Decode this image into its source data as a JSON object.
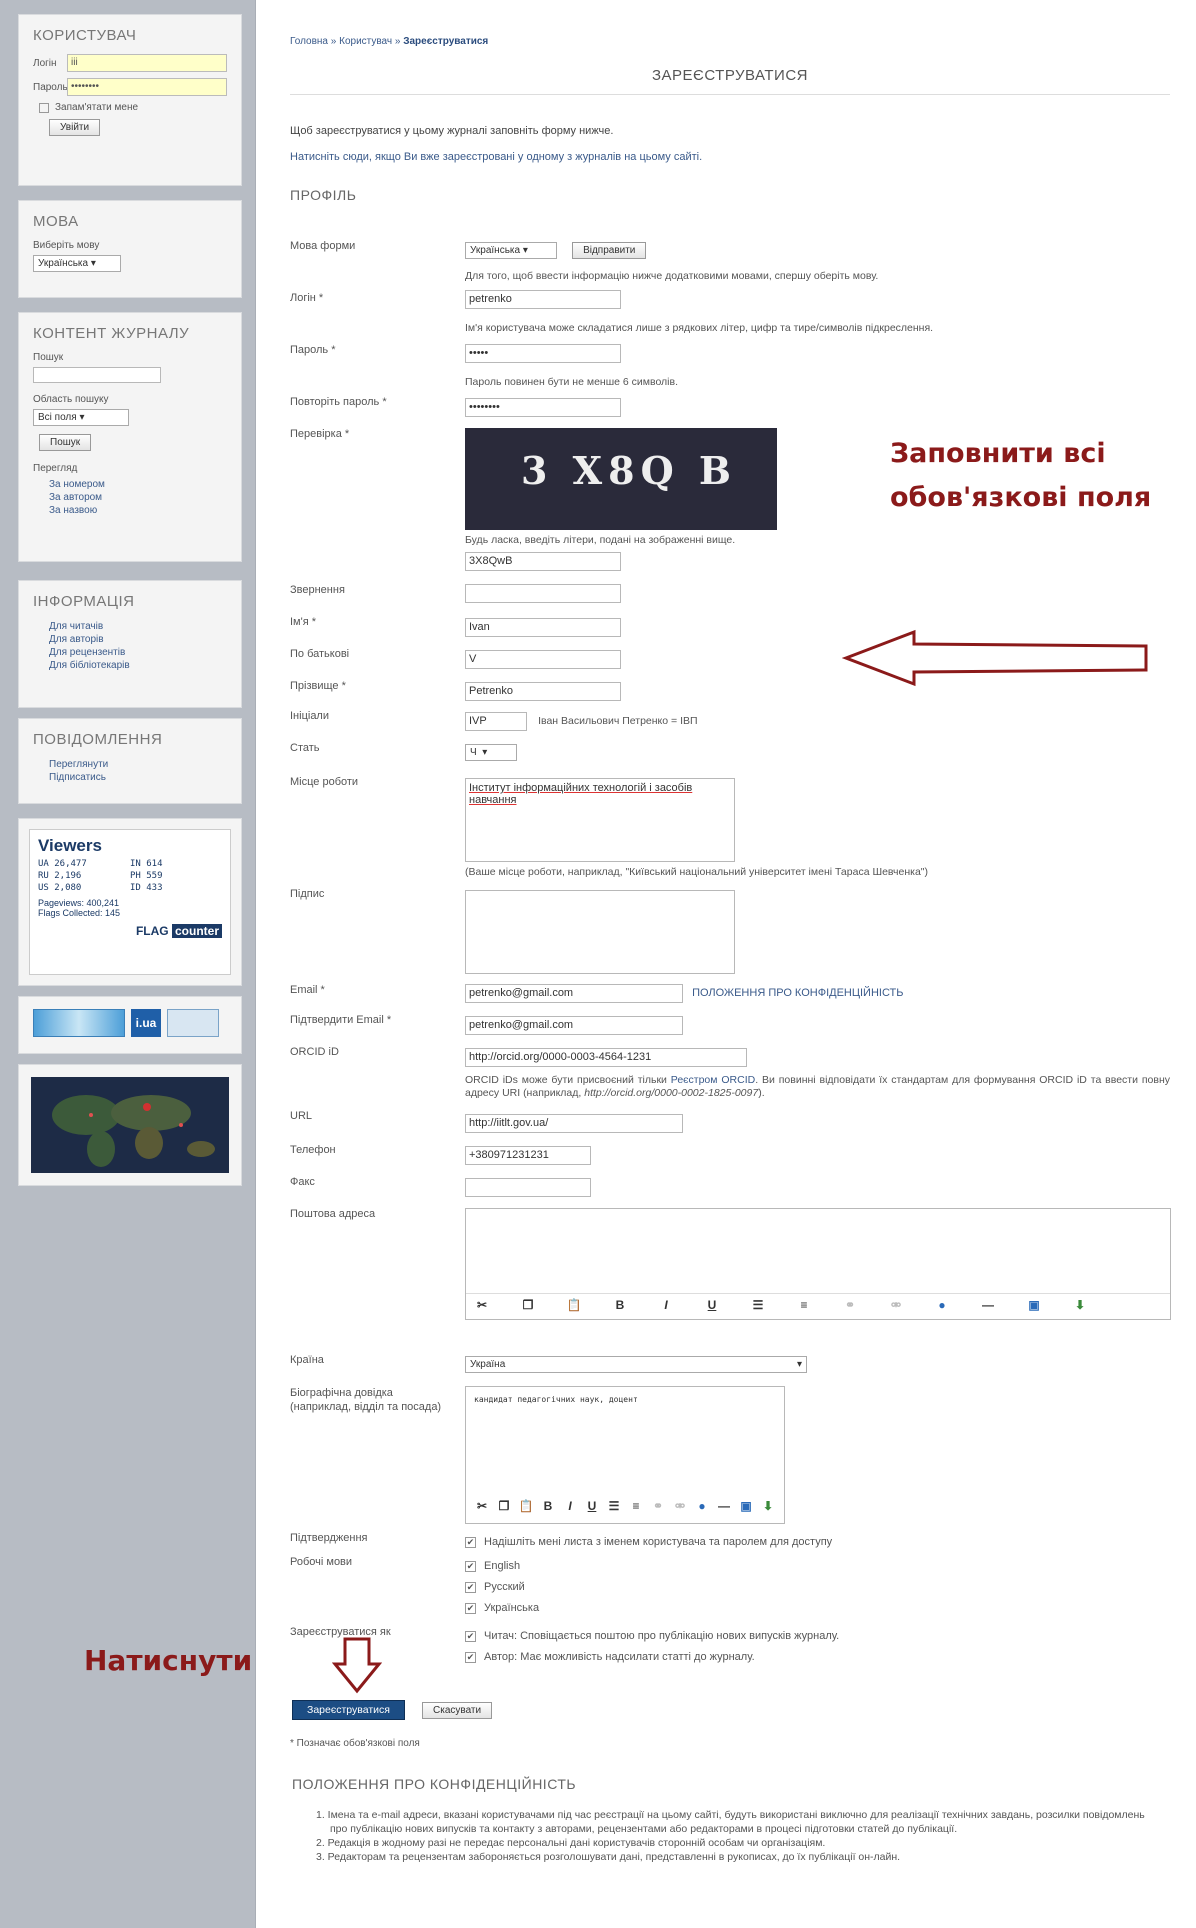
{
  "sidebar": {
    "user": {
      "title": "КОРИСТУВАЧ",
      "login_label": "Логін",
      "login_value": "iii",
      "password_label": "Пароль",
      "password_value": "••••••••",
      "remember": "Запам'ятати мене",
      "login_btn": "Увійти"
    },
    "lang": {
      "title": "МОВА",
      "choose": "Виберіть мову",
      "selected": "Українська"
    },
    "content": {
      "title": "КОНТЕНТ ЖУРНАЛУ",
      "search": "Пошук",
      "scope": "Область пошуку",
      "scope_value": "Всі поля",
      "search_btn": "Пошук",
      "browse": "Перегляд",
      "links": [
        "За номером",
        "За автором",
        "За назвою"
      ]
    },
    "info": {
      "title": "ІНФОРМАЦІЯ",
      "links": [
        "Для читачів",
        "Для авторів",
        "Для рецензентів",
        "Для бібліотекарів"
      ]
    },
    "notify": {
      "title": "ПОВІДОМЛЕННЯ",
      "links": [
        "Переглянути",
        "Підписатись"
      ]
    },
    "counter": {
      "title": "Viewers",
      "rows": [
        "UA 26,477",
        "IN 614",
        "RU 2,196",
        "PH 559",
        "US 2,080",
        "ID 433"
      ],
      "pageviews": "Pageviews: 400,241",
      "flags": "Flags Collected: 145",
      "brand1": "FLAG",
      "brand2": "counter"
    },
    "banner": {
      "label": "i.ua"
    }
  },
  "breadcrumb": {
    "home": "Головна",
    "users": "Користувач",
    "current": "Зареєструватися"
  },
  "title": "ЗАРЕЄСТРУВАТИСЯ",
  "intro": "Щоб зареєструватися у цьому журналі заповніть форму нижче.",
  "intro2": "Натисніть сюди, якщо Ви вже зареєстровані у одному з журналів на цьому сайті.",
  "profile_h": "ПРОФІЛЬ",
  "form": {
    "lang_label": "Мова форми",
    "lang_value": "Українська",
    "send_btn": "Відправити",
    "lang_hint": "Для того, щоб ввести інформацію нижче додатковими мовами, спершу оберіть мову.",
    "login_label": "Логін *",
    "login_value": "petrenko",
    "login_hint": "Ім'я користувача може складатися лише з рядкових літер, цифр та тире/символів підкреслення.",
    "pw_label": "Пароль *",
    "pw_value": "•••••",
    "pw_hint": "Пароль повинен бути не менше 6 символів.",
    "pw2_label": "Повторіть пароль *",
    "pw2_value": "••••••••",
    "captcha_label": "Перевірка *",
    "captcha_text": "3 X8Q B",
    "captcha_hint": "Будь ласка, введіть літери, подані на зображенні вище.",
    "captcha_value": "3X8QwB",
    "salutation_label": "Звернення",
    "fname_label": "Ім'я *",
    "fname_value": "Ivan",
    "mname_label": "По батькові",
    "mname_value": "V",
    "lname_label": "Прізвище *",
    "lname_value": "Petrenko",
    "initials_label": "Ініціали",
    "initials_value": "IVP",
    "initials_hint": "Іван Васильович Петренко = ІВП",
    "gender_label": "Стать",
    "gender_value": "Ч",
    "aff_label": "Місце роботи",
    "aff_value": "Інститут інформаційних технологій і засобів навчання",
    "aff_hint": "(Ваше місце роботи, наприклад, \"Київський національний університет імені Тараса Шевченка\")",
    "sig_label": "Підпис",
    "email_label": "Email *",
    "email_value": "petrenko@gmail.com",
    "privacy_link": "ПОЛОЖЕННЯ ПРО КОНФІДЕНЦІЙНІСТЬ",
    "email2_label": "Підтвердити Email *",
    "email2_value": "petrenko@gmail.com",
    "orcid_label": "ORCID iD",
    "orcid_value": "http://orcid.org/0000-0003-4564-1231",
    "orcid_hint1": "ORCID iDs може бути присвоєний тільки",
    "orcid_link": "Реєстром ORCID",
    "orcid_hint2": ". Ви повинні відповідати їх стандартам для формування ORCID iD та ввести повну адресу URI (наприклад,",
    "orcid_example": "http://orcid.org/0000-0002-1825-0097",
    "url_label": "URL",
    "url_value": "http://iitlt.gov.ua/",
    "phone_label": "Телефон",
    "phone_value": "+380971231231",
    "fax_label": "Факс",
    "addr_label": "Поштова адреса",
    "country_label": "Країна",
    "country_value": "Україна",
    "bio_label": "Біографічна довідка (наприклад, відділ та посада)",
    "bio_value": "кандидат педагогічних наук, доцент",
    "confirm_label": "Підтвердження",
    "confirm_text": "Надішліть мені листа з іменем користувача та паролем для доступу",
    "wlang_label": "Робочі мови",
    "langs": [
      "English",
      "Русский",
      "Українська"
    ],
    "regas_label": "Зареєструватися як",
    "role1": "Читач: Сповіщається поштою про публікацію нових випусків журналу.",
    "role2": "Автор: Має можливість надсилати статті до журналу.",
    "register_btn": "Зареєструватися",
    "cancel_btn": "Скасувати",
    "required_note": "* Позначає обов'язкові поля"
  },
  "privacy": {
    "title": "ПОЛОЖЕННЯ ПРО КОНФІДЕНЦІЙНІСТЬ",
    "items": [
      "1. Імена та e-mail адреси, вказані користувачами під час реєстрації на цьому сайті, будуть використані виключно для реалізації технічних завдань, розсилки повідомлень про публікацію нових випусків та контакту з авторами, рецензентами або редакторами в процесі підготовки статей до публікації.",
      "2. Редакція в жодному разі не передає персональні дані користувачів сторонній особам чи організаціям.",
      "3. Редакторам та рецензентам забороняється розголошувати дані, представленні в рукописах, до їх публікації он-лайн."
    ]
  },
  "annotations": {
    "fill": "Заповнити всі обов'язкові поля",
    "press": "Натиснути"
  }
}
